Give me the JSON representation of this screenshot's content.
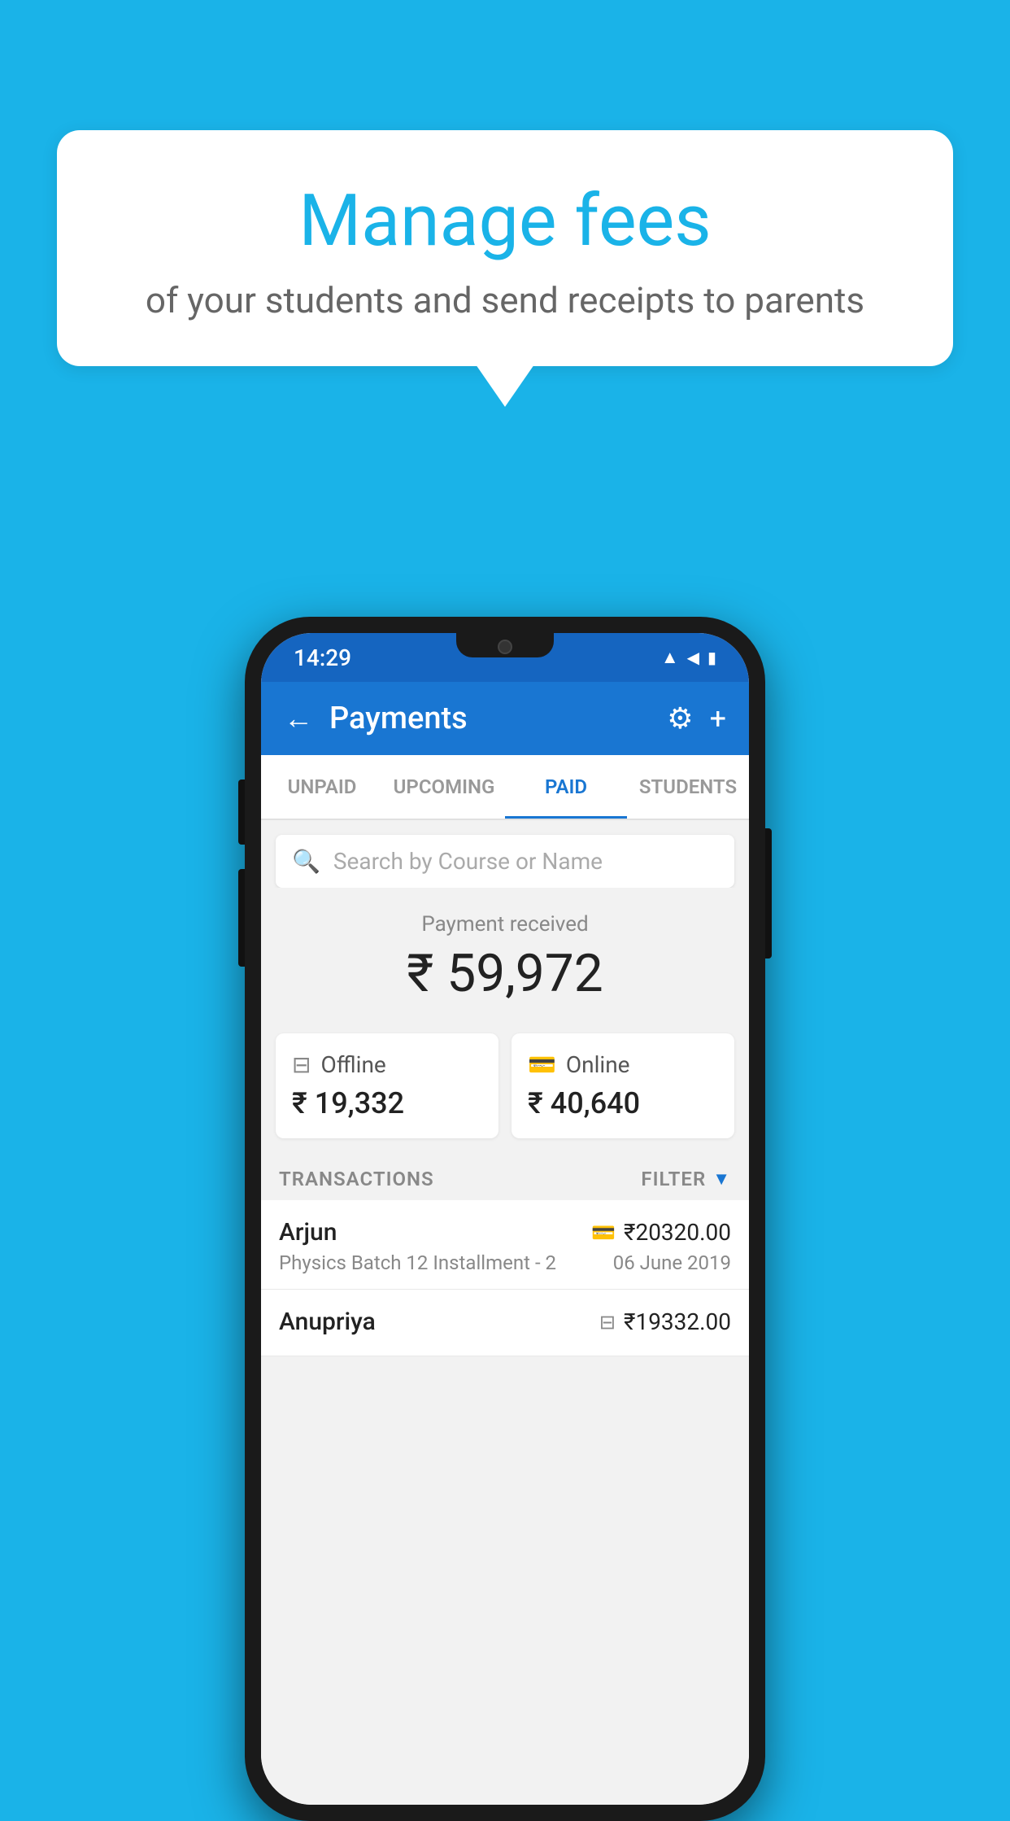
{
  "bubble": {
    "title": "Manage fees",
    "subtitle": "of your students and send receipts to parents"
  },
  "status_bar": {
    "time": "14:29",
    "wifi": "▲",
    "signal": "▲",
    "battery": "▮"
  },
  "app_bar": {
    "title": "Payments",
    "back_label": "←",
    "gear_label": "⚙",
    "plus_label": "+"
  },
  "tabs": [
    {
      "label": "UNPAID",
      "active": false
    },
    {
      "label": "UPCOMING",
      "active": false
    },
    {
      "label": "PAID",
      "active": true
    },
    {
      "label": "STUDENTS",
      "active": false
    }
  ],
  "search": {
    "placeholder": "Search by Course or Name"
  },
  "payment_section": {
    "label": "Payment received",
    "amount": "₹ 59,972",
    "offline": {
      "type": "Offline",
      "amount": "₹ 19,332"
    },
    "online": {
      "type": "Online",
      "amount": "₹ 40,640"
    }
  },
  "transactions_header": {
    "label": "TRANSACTIONS",
    "filter_label": "FILTER"
  },
  "transactions": [
    {
      "name": "Arjun",
      "amount": "₹20320.00",
      "course": "Physics Batch 12 Installment - 2",
      "date": "06 June 2019",
      "payment_type": "card"
    },
    {
      "name": "Anupriya",
      "amount": "₹19332.00",
      "course": "",
      "date": "",
      "payment_type": "offline"
    }
  ]
}
